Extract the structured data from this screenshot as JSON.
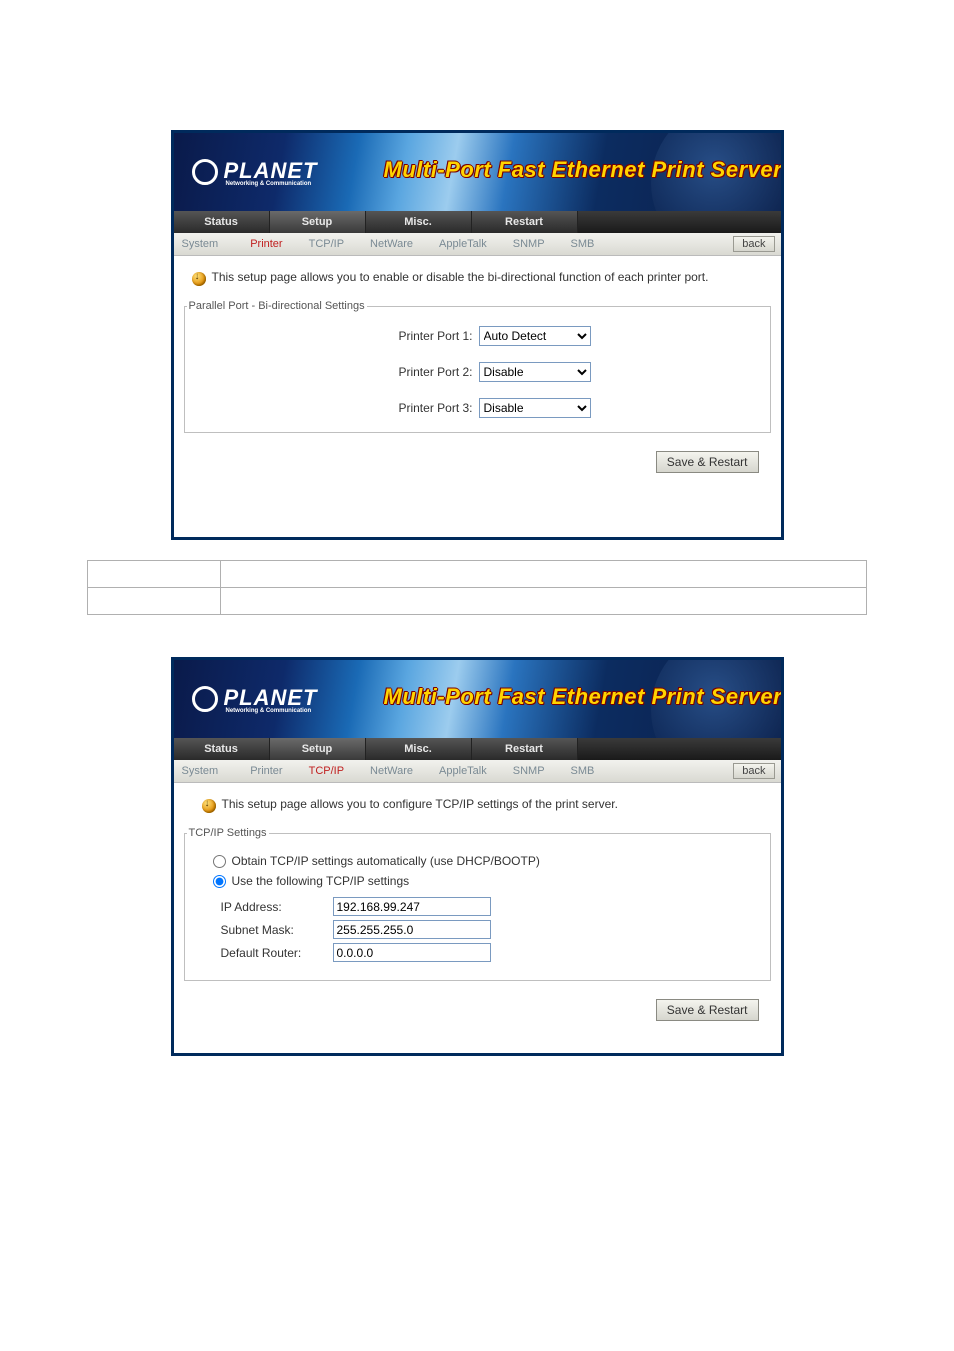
{
  "banner": {
    "logo_text": "PLANET",
    "logo_sub": "Networking & Communication",
    "title": "Multi-Port Fast Ethernet Print Server"
  },
  "tabs": {
    "status": "Status",
    "setup": "Setup",
    "misc": "Misc.",
    "restart": "Restart"
  },
  "subnav": {
    "system": "System",
    "printer": "Printer",
    "tcpip": "TCP/IP",
    "netware": "NetWare",
    "appletalk": "AppleTalk",
    "snmp": "SNMP",
    "smb": "SMB",
    "back": "back"
  },
  "printer_page": {
    "info": "This setup page allows you to enable or disable the bi-directional function of each printer port.",
    "legend": "Parallel Port - Bi-directional Settings",
    "rows": [
      {
        "label": "Printer Port 1:",
        "value": "Auto Detect"
      },
      {
        "label": "Printer Port 2:",
        "value": "Disable"
      },
      {
        "label": "Printer Port 3:",
        "value": "Disable"
      }
    ],
    "save": "Save & Restart"
  },
  "tcpip_page": {
    "info": "This setup page allows you to configure TCP/IP settings of the print server.",
    "legend": "TCP/IP Settings",
    "radio_dhcp": "Obtain TCP/IP settings automatically (use DHCP/BOOTP)",
    "radio_static": "Use the following TCP/IP settings",
    "fields": {
      "ip_label": "IP Address:",
      "ip_value": "192.168.99.247",
      "mask_label": "Subnet Mask:",
      "mask_value": "255.255.255.0",
      "router_label": "Default Router:",
      "router_value": "0.0.0.0"
    },
    "save": "Save & Restart"
  }
}
